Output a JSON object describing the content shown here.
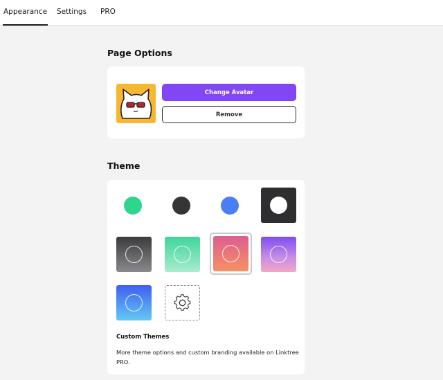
{
  "tabs": [
    {
      "label": "Appearance",
      "active": true
    },
    {
      "label": "Settings",
      "active": false
    },
    {
      "label": "PRO",
      "active": false
    }
  ],
  "page_options": {
    "title": "Page Options",
    "avatar_icon": "cat-with-sunglasses",
    "change_avatar_label": "Change Avatar",
    "remove_label": "Remove"
  },
  "theme": {
    "title": "Theme",
    "colors": {
      "dot_green": "#2ed58f",
      "dot_dark": "#353535",
      "dot_blue": "#4a7ef5",
      "accent": "#8247f5"
    },
    "selected_tile": "pink-orange-gradient",
    "custom_themes_title": "Custom Themes",
    "custom_themes_description": "More theme options and custom branding available on Linktree PRO."
  }
}
